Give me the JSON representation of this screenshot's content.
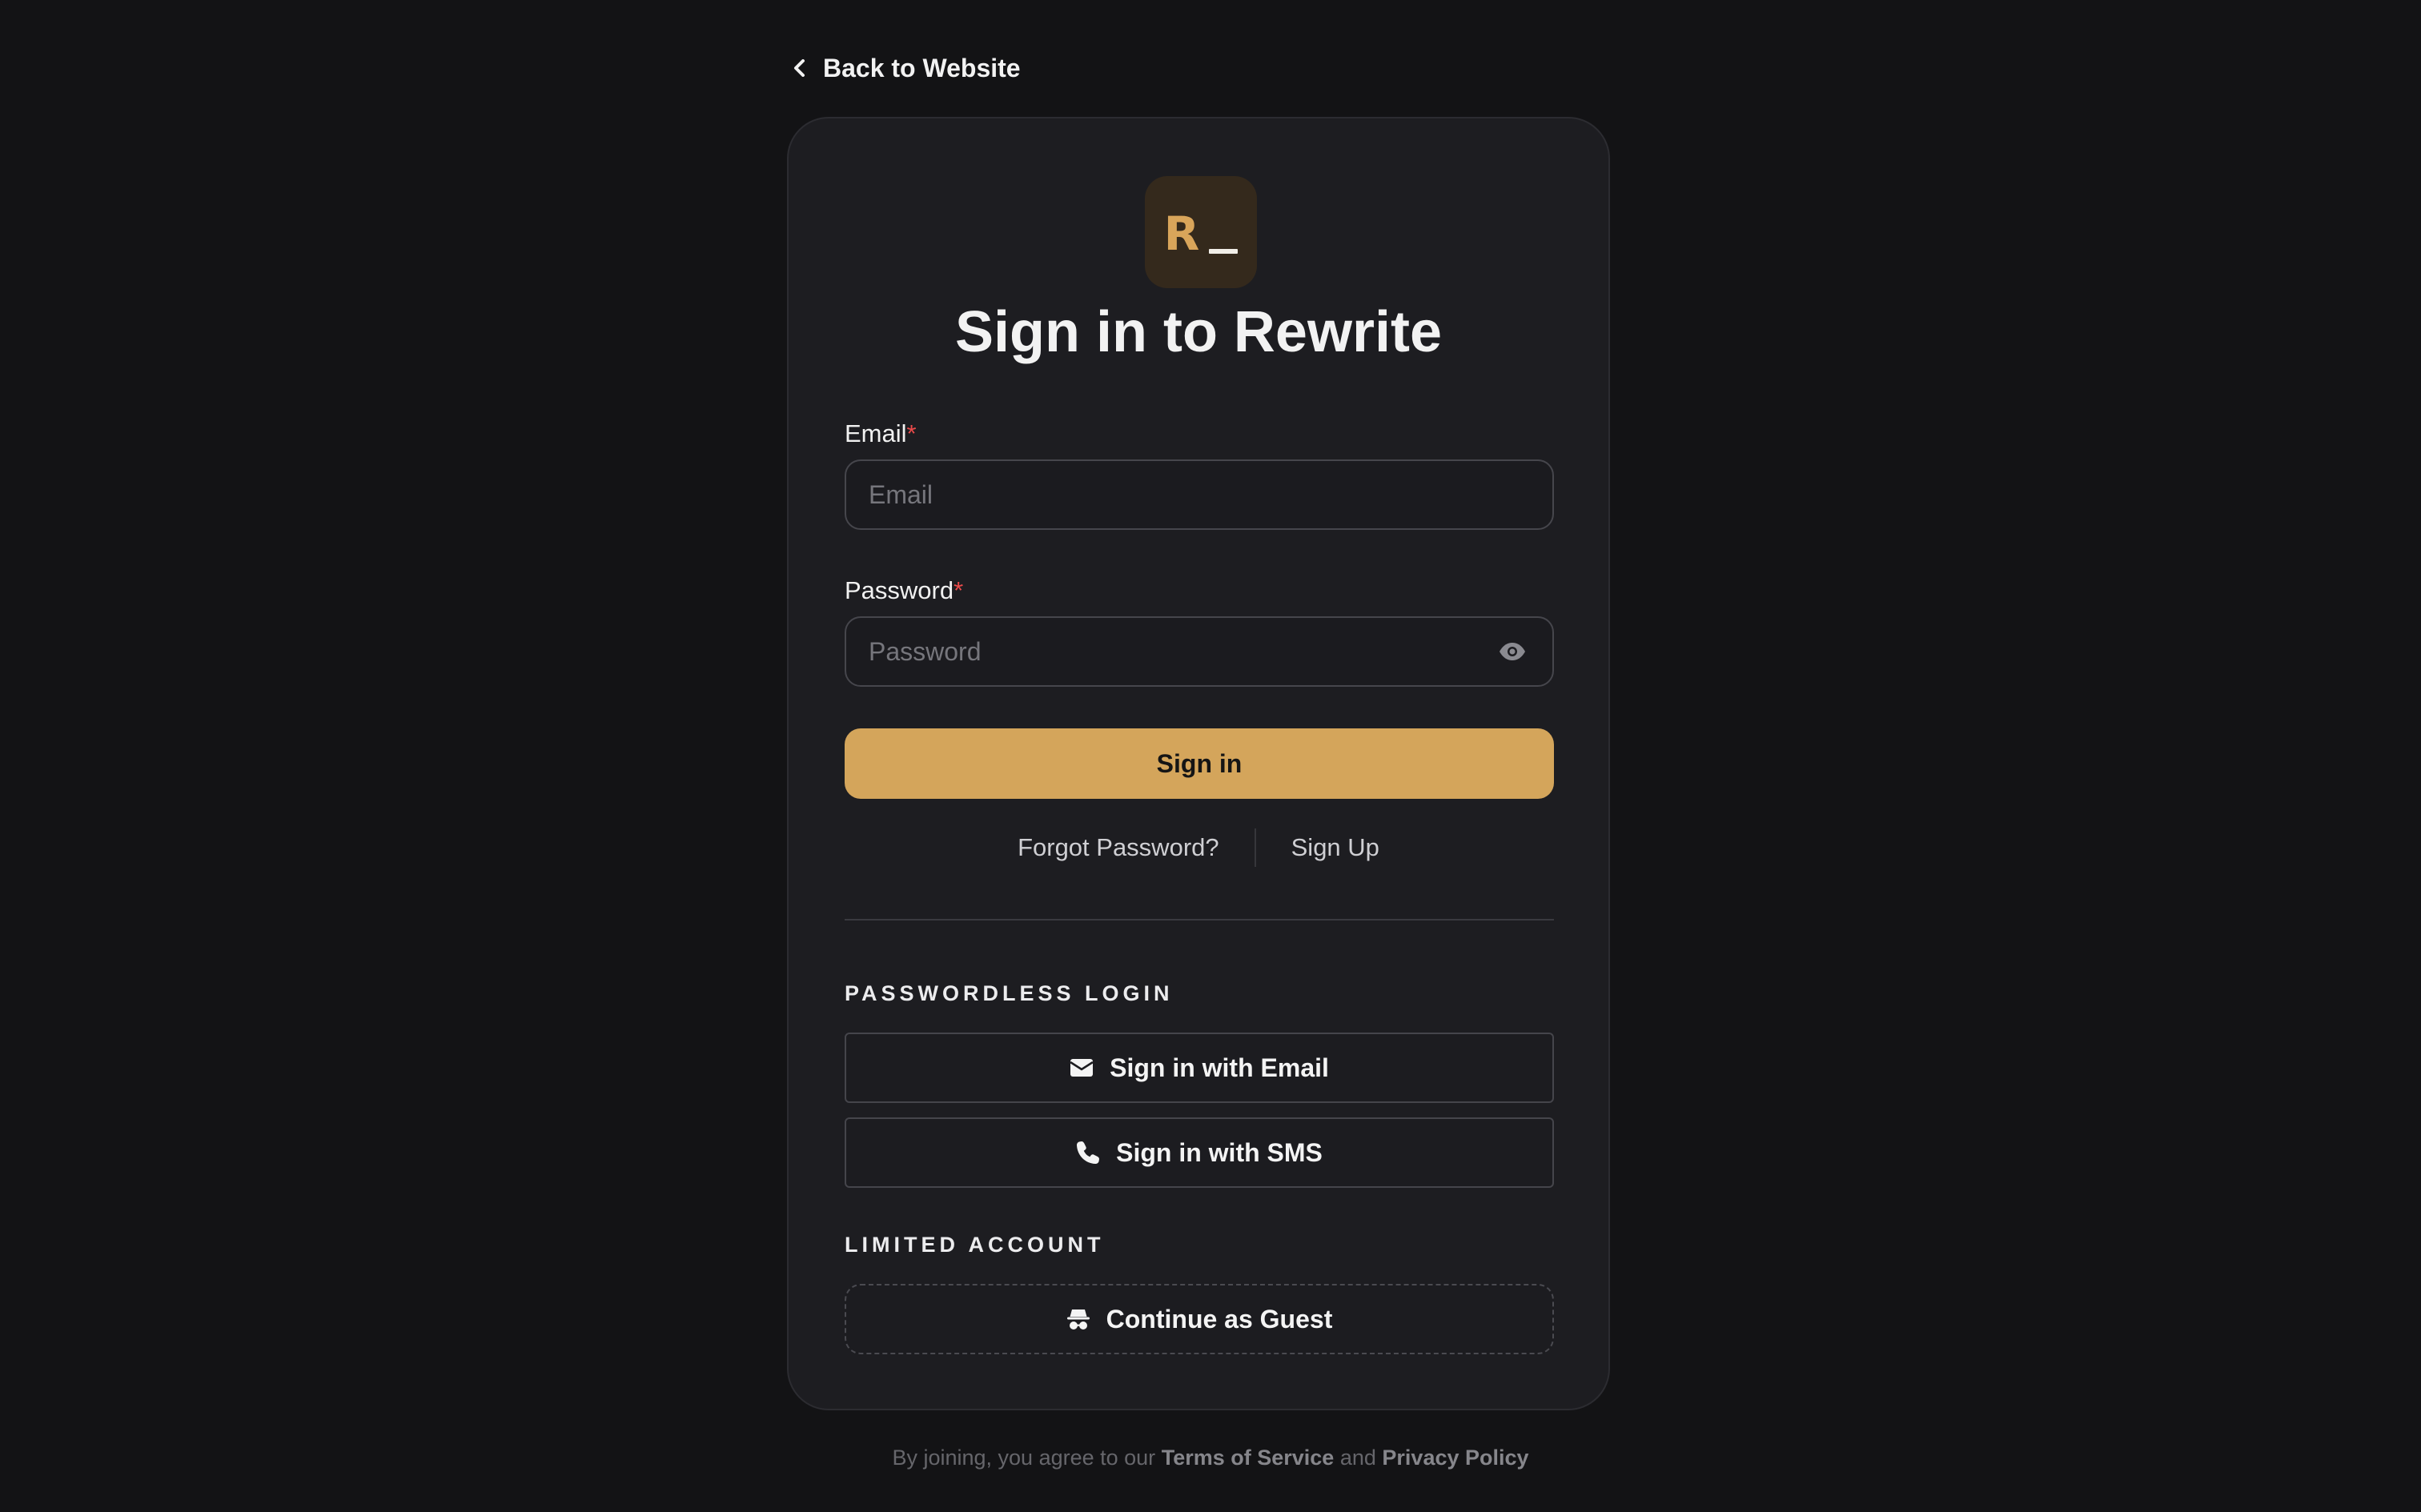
{
  "nav": {
    "back_label": "Back to Website",
    "back_icon": "chevron-left-icon"
  },
  "logo": {
    "letter": "R",
    "cursor": "_"
  },
  "title": "Sign in to Rewrite",
  "form": {
    "email": {
      "label": "Email",
      "required_mark": "*",
      "placeholder": "Email",
      "value": ""
    },
    "password": {
      "label": "Password",
      "required_mark": "*",
      "placeholder": "Password",
      "value": "",
      "toggle_icon": "eye-icon"
    },
    "submit_label": "Sign in"
  },
  "links": {
    "forgot_password": "Forgot Password?",
    "sign_up": "Sign Up"
  },
  "passwordless": {
    "heading": "PASSWORDLESS LOGIN",
    "email_button": "Sign in with Email",
    "email_icon": "envelope-icon",
    "sms_button": "Sign in with SMS",
    "sms_icon": "phone-icon"
  },
  "limited": {
    "heading": "LIMITED ACCOUNT",
    "guest_button": "Continue as Guest",
    "guest_icon": "incognito-icon"
  },
  "footer": {
    "prefix": "By joining, you agree to our",
    "terms": "Terms of Service",
    "and": "and",
    "privacy": "Privacy Policy"
  },
  "colors": {
    "background": "#131315",
    "card": "#1d1d21",
    "accent": "#d4a55b",
    "required": "#ea4a4a"
  }
}
